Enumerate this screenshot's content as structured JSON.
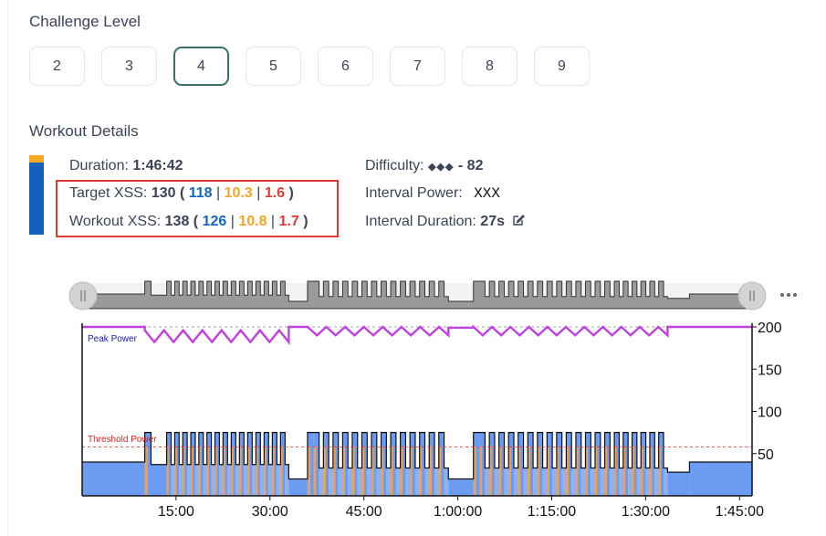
{
  "challenge_level": {
    "title": "Challenge Level",
    "levels": [
      "2",
      "3",
      "4",
      "5",
      "6",
      "7",
      "8",
      "9"
    ],
    "selected": "4"
  },
  "workout_details": {
    "title": "Workout Details",
    "duration_label": "Duration:",
    "duration_value": "1:46:42",
    "target_label": "Target XSS:",
    "target_total": "130",
    "target_parts": [
      "118",
      "10.3",
      "1.6"
    ],
    "workout_label": "Workout XSS:",
    "workout_total": "138",
    "workout_parts": [
      "126",
      "10.8",
      "1.7"
    ],
    "difficulty_label": "Difficulty:",
    "difficulty_icons": "◆◆◆",
    "difficulty_value": "- 82",
    "interval_power_label": "Interval Power:",
    "interval_power_value": "XXX",
    "interval_duration_label": "Interval Duration:",
    "interval_duration_value": "27s",
    "edit_icon": "pencil-icon",
    "more_icon": "ellipsis-icon"
  },
  "colors": {
    "blue": "#1565c0",
    "orange": "#f5a623",
    "red": "#e53935",
    "peak_line": "#c040e0",
    "area_fill": "#6b9cf2",
    "selected_border": "#3a6f6a"
  },
  "chart_data": {
    "type": "area",
    "x_unit": "minutes",
    "xlim": [
      0,
      107
    ],
    "ylim": [
      0,
      200
    ],
    "yticks": [
      50,
      100,
      150,
      200
    ],
    "xtick_labels": [
      "15:00",
      "30:00",
      "45:00",
      "1:00:00",
      "1:15:00",
      "1:30:00",
      "1:45:00"
    ],
    "xtick_minutes": [
      15,
      30,
      45,
      60,
      75,
      90,
      105
    ],
    "annotations": [
      {
        "text": "Peak Power",
        "color": "#1a1ab0",
        "value": 200
      },
      {
        "text": "Threshold Power",
        "color": "#e02020",
        "value": 58
      }
    ],
    "segments_minutes": [
      {
        "start": 0,
        "end": 10,
        "power": 40
      },
      {
        "start": 10,
        "end": 11,
        "power": 75
      },
      {
        "start": 11,
        "end": 13.5,
        "power": 37
      },
      {
        "start": 13.5,
        "end": 22.5,
        "power": 75,
        "repeats": 7,
        "rest": 37
      },
      {
        "start": 22.5,
        "end": 33,
        "power": 75,
        "repeats": 8,
        "rest": 37
      },
      {
        "start": 33,
        "end": 36,
        "power": 20
      },
      {
        "start": 36,
        "end": 37,
        "power": 75
      },
      {
        "start": 37,
        "end": 58.5,
        "power": 75,
        "repeats": 14,
        "rest": 33
      },
      {
        "start": 58.5,
        "end": 62.5,
        "power": 20
      },
      {
        "start": 62.5,
        "end": 63.5,
        "power": 75
      },
      {
        "start": 63.5,
        "end": 85,
        "power": 75,
        "repeats": 14,
        "rest": 33
      },
      {
        "start": 85,
        "end": 93.5,
        "power": 75,
        "repeats": 6,
        "rest": 33
      },
      {
        "start": 93.5,
        "end": 97,
        "power": 28
      },
      {
        "start": 97,
        "end": 107,
        "power": 40
      }
    ],
    "peak_power_series": [
      {
        "start": 0,
        "end": 10,
        "value": 200
      },
      {
        "start": 10,
        "end": 33,
        "value": 192,
        "dip": 182
      },
      {
        "start": 33,
        "end": 36,
        "value": 200
      },
      {
        "start": 36,
        "end": 58.5,
        "value": 196,
        "dip": 190
      },
      {
        "start": 58.5,
        "end": 62.5,
        "value": 199
      },
      {
        "start": 62.5,
        "end": 93.5,
        "value": 196,
        "dip": 190
      },
      {
        "start": 93.5,
        "end": 107,
        "value": 200
      }
    ]
  }
}
